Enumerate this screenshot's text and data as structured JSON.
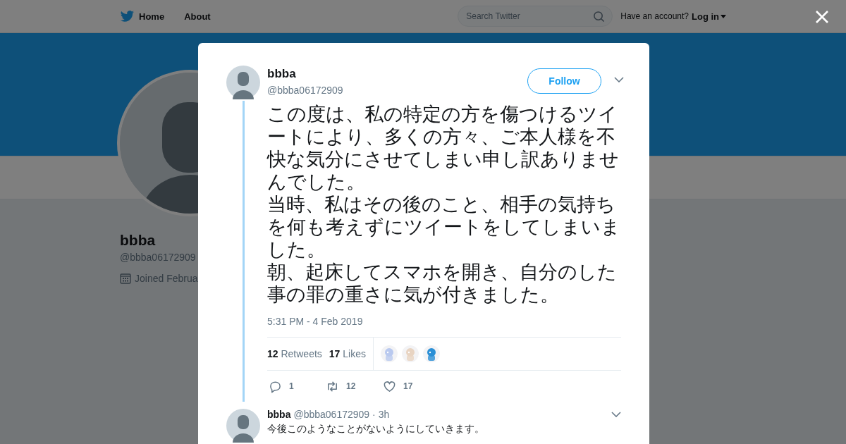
{
  "nav": {
    "items": [
      {
        "label": "Home",
        "kind": "home"
      },
      {
        "label": "About",
        "kind": "plain"
      }
    ],
    "search": {
      "placeholder": "Search Twitter"
    },
    "account_prompt": "Have an account?",
    "login": "Log in"
  },
  "profile": {
    "name": "bbba",
    "handle": "@bbba06172909",
    "joined": "Joined Februa"
  },
  "tweet": {
    "name": "bbba",
    "handle": "@bbba06172909",
    "follow": "Follow",
    "paragraphs": [
      "この度は、私の特定の方を傷つけるツイートにより、多くの方々、ご本人様を不快な気分にさせてしまい申し訳ありませんでした。",
      "当時、私はその後のこと、相手の気持ちを何も考えずにツイートをしてしまいました。",
      "朝、起床してスマホを開き、自分のした事の罪の重さに気が付きました。"
    ],
    "timestamp": "5:31 PM - 4 Feb 2019",
    "retweets": {
      "count": "12",
      "label": "Retweets"
    },
    "likes": {
      "count": "17",
      "label": "Likes"
    },
    "actions": [
      {
        "kind": "reply",
        "count": "1"
      },
      {
        "kind": "retweet",
        "count": "12"
      },
      {
        "kind": "like",
        "count": "17"
      }
    ]
  },
  "reply": {
    "name": "bbba",
    "handle": "@bbba06172909",
    "time": "· 3h",
    "text": "今後このようなことがないようにしていきます。"
  }
}
